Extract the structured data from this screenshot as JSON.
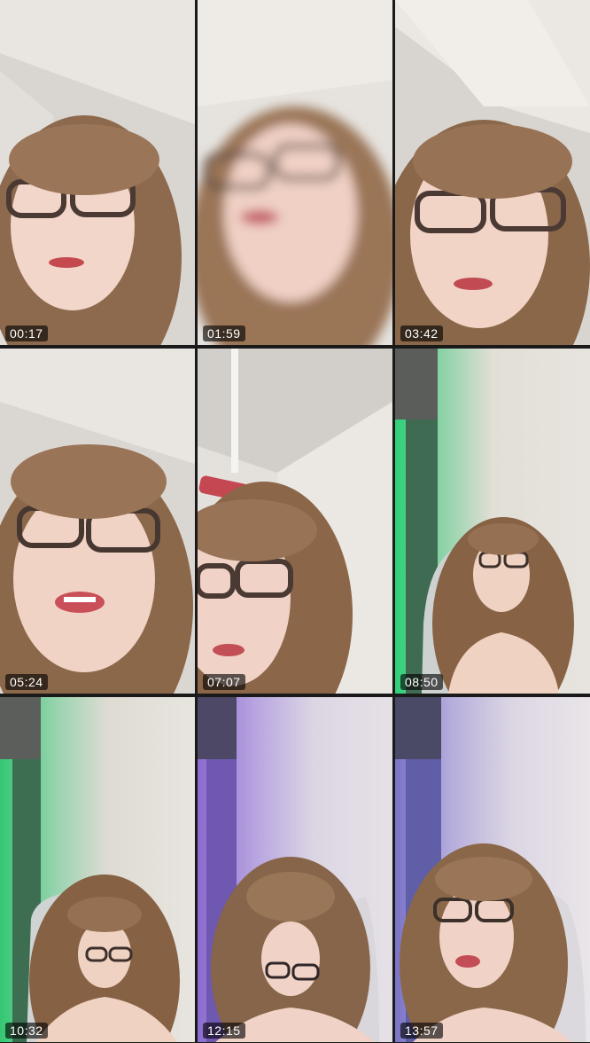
{
  "clips": [
    {
      "timestamp": "00:17",
      "scene": "closeup"
    },
    {
      "timestamp": "01:59",
      "scene": "blur"
    },
    {
      "timestamp": "03:42",
      "scene": "closeup"
    },
    {
      "timestamp": "05:24",
      "scene": "closeup"
    },
    {
      "timestamp": "07:07",
      "scene": "low-angle"
    },
    {
      "timestamp": "08:50",
      "scene": "chair-green"
    },
    {
      "timestamp": "10:32",
      "scene": "chair-green"
    },
    {
      "timestamp": "12:15",
      "scene": "chair-purple"
    },
    {
      "timestamp": "13:57",
      "scene": "chair-purple"
    }
  ],
  "colors": {
    "background": "#1a1a1a",
    "wall_light": "#e8e4df",
    "hair": "#8a6548",
    "skin": "#f0d2c4",
    "green_light": "#3fcf7a",
    "purple_light": "#9b7fd8",
    "timestamp_bg": "#000000"
  }
}
